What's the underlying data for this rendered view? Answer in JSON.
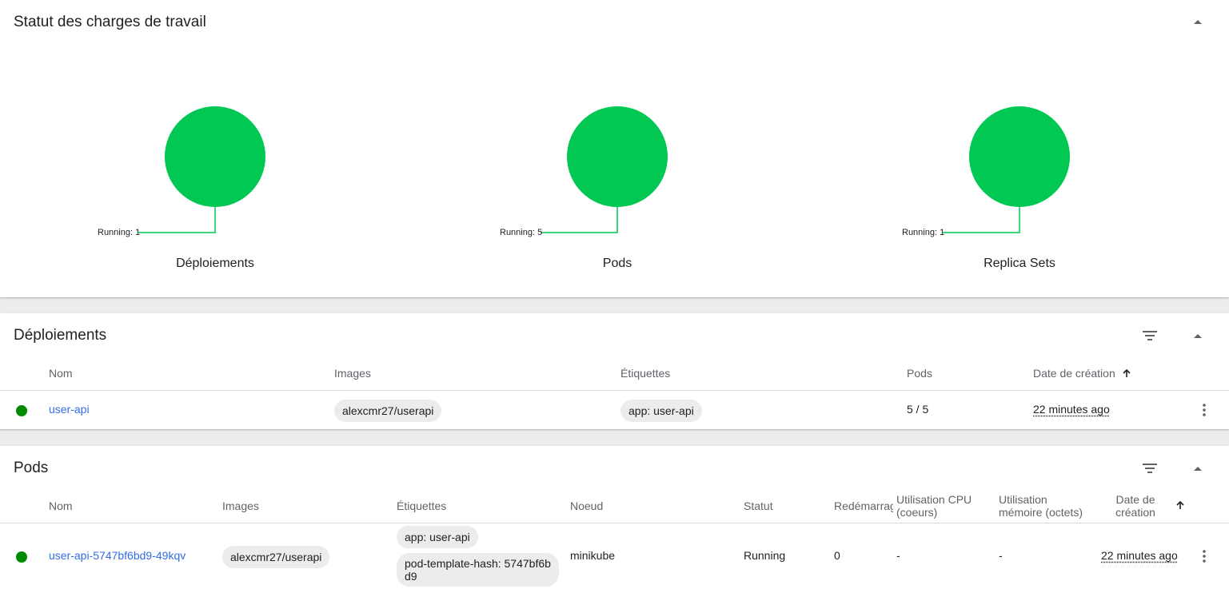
{
  "workload_status": {
    "title": "Statut des charges de travail",
    "charts": [
      {
        "caption": "Déploiements",
        "label": "Running: 1",
        "running": 1
      },
      {
        "caption": "Pods",
        "label": "Running: 5",
        "running": 5
      },
      {
        "caption": "Replica Sets",
        "label": "Running: 1",
        "running": 1
      }
    ],
    "running_color": "#00c853"
  },
  "deployments": {
    "title": "Déploiements",
    "columns": [
      "Nom",
      "Images",
      "Étiquettes",
      "Pods",
      "Date de création"
    ],
    "rows": [
      {
        "name": "user-api",
        "image": "alexcmr27/userapi",
        "label": "app: user-api",
        "pods": "5 / 5",
        "created": "22 minutes ago"
      }
    ]
  },
  "pods": {
    "title": "Pods",
    "columns": {
      "name": "Nom",
      "images": "Images",
      "labels": "Étiquettes",
      "node": "Noeud",
      "status": "Statut",
      "restarts": "Redémarrages",
      "cpu_line1": "Utilisation CPU",
      "cpu_line2": "(coeurs)",
      "mem_line1": "Utilisation",
      "mem_line2": "mémoire (octets)",
      "created_line1": "Date de",
      "created_line2": "création"
    },
    "rows": [
      {
        "name": "user-api-5747bf6bd9-49kqv",
        "image": "alexcmr27/userapi",
        "label1": "app: user-api",
        "label2_line1": "pod-template-hash: 5747bf6b",
        "label2_line2": "d9",
        "node": "minikube",
        "status": "Running",
        "restarts": "0",
        "cpu": "-",
        "memory": "-",
        "created": "22 minutes ago"
      }
    ]
  },
  "status_dot_color": "#008a00",
  "link_color": "#326de6"
}
